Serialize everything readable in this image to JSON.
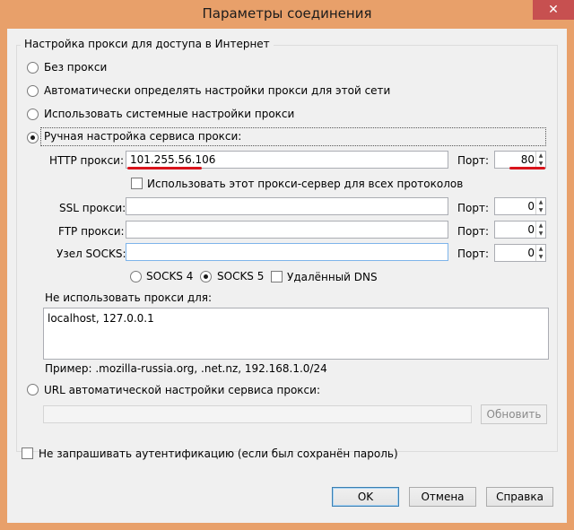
{
  "window": {
    "title": "Параметры соединения",
    "close_label": "✕"
  },
  "group": {
    "title": "Настройка прокси для доступа в Интернет"
  },
  "proxy_modes": [
    {
      "label": "Без прокси",
      "checked": false
    },
    {
      "label": "Автоматически определять настройки прокси для этой сети",
      "checked": false
    },
    {
      "label": "Использовать системные настройки прокси",
      "checked": false
    },
    {
      "label": "Ручная настройка сервиса прокси:",
      "checked": true
    }
  ],
  "manual": {
    "http": {
      "label": "HTTP прокси:",
      "value": "101.255.56.106",
      "port_label": "Порт:",
      "port": "80"
    },
    "use_for_all": {
      "label": "Использовать этот прокси-сервер для всех протоколов",
      "checked": false
    },
    "ssl": {
      "label": "SSL прокси:",
      "value": "",
      "port_label": "Порт:",
      "port": "0"
    },
    "ftp": {
      "label": "FTP прокси:",
      "value": "",
      "port_label": "Порт:",
      "port": "0"
    },
    "socks": {
      "label": "Узел SOCKS:",
      "value": "",
      "port_label": "Порт:",
      "port": "0"
    },
    "socks_versions": [
      {
        "label": "SOCKS 4",
        "checked": false
      },
      {
        "label": "SOCKS 5",
        "checked": true
      }
    ],
    "remote_dns": {
      "label": "Удалённый DNS",
      "checked": false
    },
    "no_proxy_label": "Не использовать прокси для:",
    "no_proxy_value": "localhost, 127.0.0.1",
    "example": "Пример: .mozilla-russia.org, .net.nz, 192.168.1.0/24"
  },
  "auto_url": {
    "label": "URL автоматической настройки сервиса прокси:",
    "checked": false,
    "value": "",
    "reload_label": "Обновить"
  },
  "no_auth_prompt": {
    "label": "Не запрашивать аутентификацию (если был сохранён пароль)",
    "checked": false
  },
  "buttons": {
    "ok": "OK",
    "cancel": "Отмена",
    "help": "Справка"
  },
  "colors": {
    "titlebar": "#e8a06a",
    "close": "#c75050",
    "annotation": "#d9141c"
  }
}
